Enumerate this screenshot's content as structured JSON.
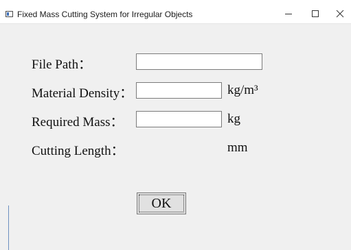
{
  "window": {
    "title": "Fixed Mass Cutting System for Irregular Objects",
    "controls": [
      "minimize",
      "maximize",
      "close"
    ]
  },
  "form": {
    "file_path_label": "File Path：",
    "file_path_value": "",
    "density_label": "Material Density：",
    "density_value": "",
    "density_unit": "kg/m³",
    "mass_label": "Required Mass：",
    "mass_value": "",
    "mass_unit": "kg",
    "cutting_label": "Cutting Length：",
    "cutting_value": "",
    "cutting_unit": "mm",
    "ok_label": "OK"
  },
  "icons": {
    "app": "app-window-icon",
    "minimize": "minimize-icon",
    "maximize": "maximize-icon",
    "close": "close-icon"
  },
  "colors": {
    "window_bg": "#f0f0f0",
    "titlebar_bg": "#ffffff",
    "field_border": "#7a7a7a",
    "button_bg": "#e1e1e1"
  }
}
